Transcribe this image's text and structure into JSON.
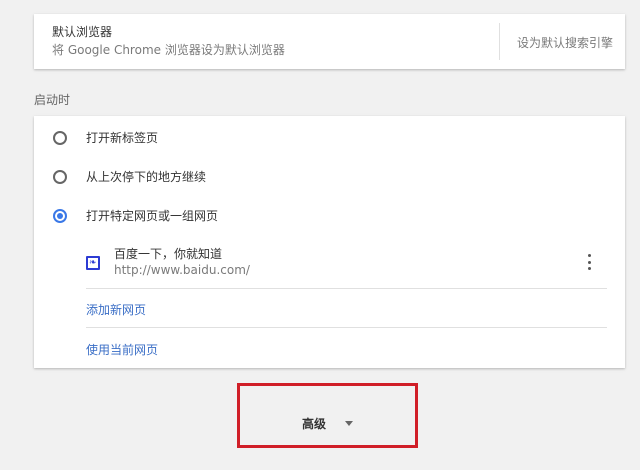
{
  "default_browser": {
    "title": "默认浏览器",
    "subtitle": "将 Google Chrome 浏览器设为默认浏览器",
    "set_default_link": "设为默认搜索引擎"
  },
  "startup": {
    "section_label": "启动时",
    "options": [
      {
        "label": "打开新标签页",
        "checked": false
      },
      {
        "label": "从上次停下的地方继续",
        "checked": false
      },
      {
        "label": "打开特定网页或一组网页",
        "checked": true
      }
    ],
    "pages": [
      {
        "title": "百度一下，你就知道",
        "url": "http://www.baidu.com/",
        "icon": "baidu-paw-icon"
      }
    ],
    "add_page_link": "添加新网页",
    "use_current_link": "使用当前网页"
  },
  "advanced": {
    "label": "高级",
    "icon": "caret-down-icon",
    "highlight_color": "#d01e27"
  },
  "colors": {
    "accent": "#3a78e7",
    "link": "#3a6ec6",
    "background": "#f1f1f1"
  }
}
